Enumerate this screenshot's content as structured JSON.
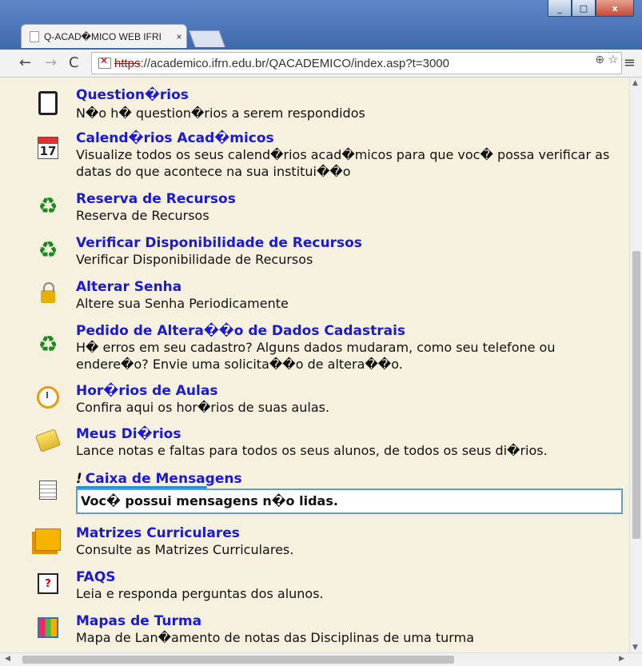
{
  "browser": {
    "tab_title": "Q-ACAD�MICO WEB IFRI",
    "tab_close": "×",
    "url_scheme": "https",
    "url_rest": "://academico.ifrn.edu.br/QACADEMICO/index.asp?t=3000",
    "window_buttons": [
      "_",
      "□",
      "x"
    ]
  },
  "items": [
    {
      "title": "Question�rios",
      "desc": "N�o h� question�rios a serem respondidos",
      "icon": "clipboard-icon"
    },
    {
      "title": "Calend�rios Acad�micos",
      "desc": "Visualize todos os seus calend�rios acad�micos para que voc� possa verificar as datas do que acontece na sua institui��o",
      "icon": "calendar-icon",
      "icon_text": "17"
    },
    {
      "title": "Reserva de Recursos",
      "desc": "Reserva de Recursos",
      "icon": "recycle-icon"
    },
    {
      "title": "Verificar Disponibilidade de Recursos",
      "desc": "Verificar Disponibilidade de Recursos",
      "icon": "recycle-icon"
    },
    {
      "title": "Alterar Senha",
      "desc": "Altere sua Senha Periodicamente",
      "icon": "padlock-icon"
    },
    {
      "title": "Pedido de Altera��o de Dados Cadastrais",
      "desc": "H� erros em seu cadastro? Alguns dados mudaram, como seu telefone ou endere�o? Envie uma solicita��o de altera��o.",
      "icon": "recycle-icon"
    },
    {
      "title": "Hor�rios de Aulas",
      "desc": "Confira aqui os hor�rios de suas aulas.",
      "icon": "clock-icon"
    },
    {
      "title": "Meus Di�rios",
      "desc": "Lance notas e faltas para todos os seus alunos, de todos os seus di�rios.",
      "icon": "notebook-icon"
    },
    {
      "title": "Caixa de Mensagens",
      "title_prefix": "!",
      "desc": "Voc� possui mensagens n�o lidas.",
      "icon": "messages-icon"
    },
    {
      "title": "Matrizes Curriculares",
      "desc": "Consulte as Matrizes Curriculares.",
      "icon": "folders-icon"
    },
    {
      "title": "FAQS",
      "desc": "Leia e responda perguntas dos alunos.",
      "icon": "faq-icon",
      "icon_text": "?"
    },
    {
      "title": "Mapas de Turma",
      "desc": "Mapa de Lan�amento de notas das Disciplinas de uma turma",
      "icon": "grid-icon"
    }
  ]
}
